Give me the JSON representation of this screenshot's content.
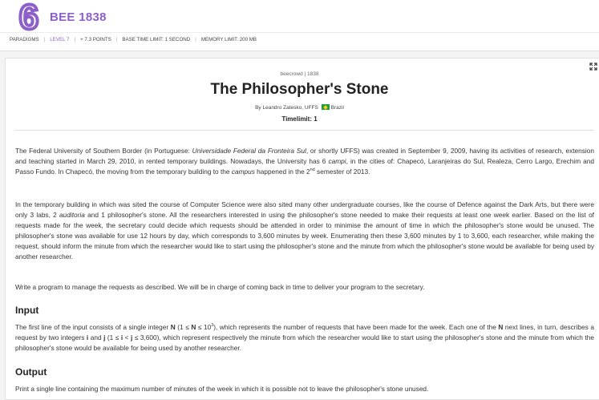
{
  "header": {
    "logo_glyph": "6",
    "problem_id": "BEE 1838",
    "meta": [
      "PARADIGMS",
      "LEVEL 7",
      "+ 7.3 POINTS",
      "BASE TIME LIMIT: 1 SECOND",
      "MEMORY LIMIT: 200 MB"
    ],
    "accent_color": "#8d5fc9"
  },
  "problem": {
    "source": "beecrowd | 1838",
    "title": "The Philosopher's Stone",
    "author_prefix": "By Leandro Zatesko, UFFS",
    "country": "Brazil",
    "timelimit": "Timelimit: 1",
    "p1": {
      "a": "The Federal University of Southern Border (in Portuguese: ",
      "b": "Universidade Federal da Fronteira Sul",
      "c": ", or shortly UFFS) was created in September 9, 2009, having its activities of research, extension and teaching started in March 29, 2010, in rented temporary buildings. Nowadays, the University has 6 ",
      "d": "campi",
      "e": ", in the cities of: Chapecó, Laranjeiras do Sul, Realeza, Cerro Largo, Erechim and Passo Fundo. In Chapecó, the moving from the temporary building to the ",
      "f": "campus",
      "g": " happened in the 2",
      "sup": "nd",
      "h": " semester of 2013."
    },
    "p2": {
      "a": "In the temporary building in which was sited the course of Computer Science were also sited many other undergraduate courses, like the course of Defence against the Dark Arts, but there were only 3 labs, 2 ",
      "b": "auditoria",
      "c": " and 1 philosopher's stone. All the researchers interested in using the philosopher's stone needed to make their requests at least one week earlier. Based on the list of requests made for the week, the secretary could decide which requests should be attended in order to minimise the amount of time in which the philosopher's stone would be unused. The philosopher's stone was available for use 12 hours by day, which corresponds to 3,600 minutes by week. Enumerating then these 3,600 minutes by 1 to 3,600, each researcher, while making the request, should inform the minute from which the researcher would like to start using the philosopher's stone and the minute from which the philosopher's stone would be available for being used by another researcher."
    },
    "p3": "Write a program to manage the requests as described. We will be in charge of coming back in time to deliver your program to the secretary.",
    "input_heading": "Input",
    "input": {
      "a": "The first line of the input consists of a single integer ",
      "n1": "N",
      "b": " (1 ≤ ",
      "n2": "N",
      "c": " ≤ 10",
      "sup": "3",
      "d": "), which represents the number of requests that have been made for the week. Each one of the ",
      "n3": "N",
      "e": " next lines, in turn, describes a request by two integers ",
      "i1": "i",
      "f": " and ",
      "j1": "j",
      "g": " (1 ≤ ",
      "i2": "i",
      "h": " < ",
      "j2": "j",
      "k": " ≤ 3,600), which represent respectively the minute from which the researcher would like to start using the philosopher's stone and the minute from which the philosopher's stone would be available for being used by another researcher."
    },
    "output_heading": "Output",
    "output": "Print a single line containing the maximum number of minutes of the week in which it is possible not to leave the philosopher's stone unused."
  }
}
